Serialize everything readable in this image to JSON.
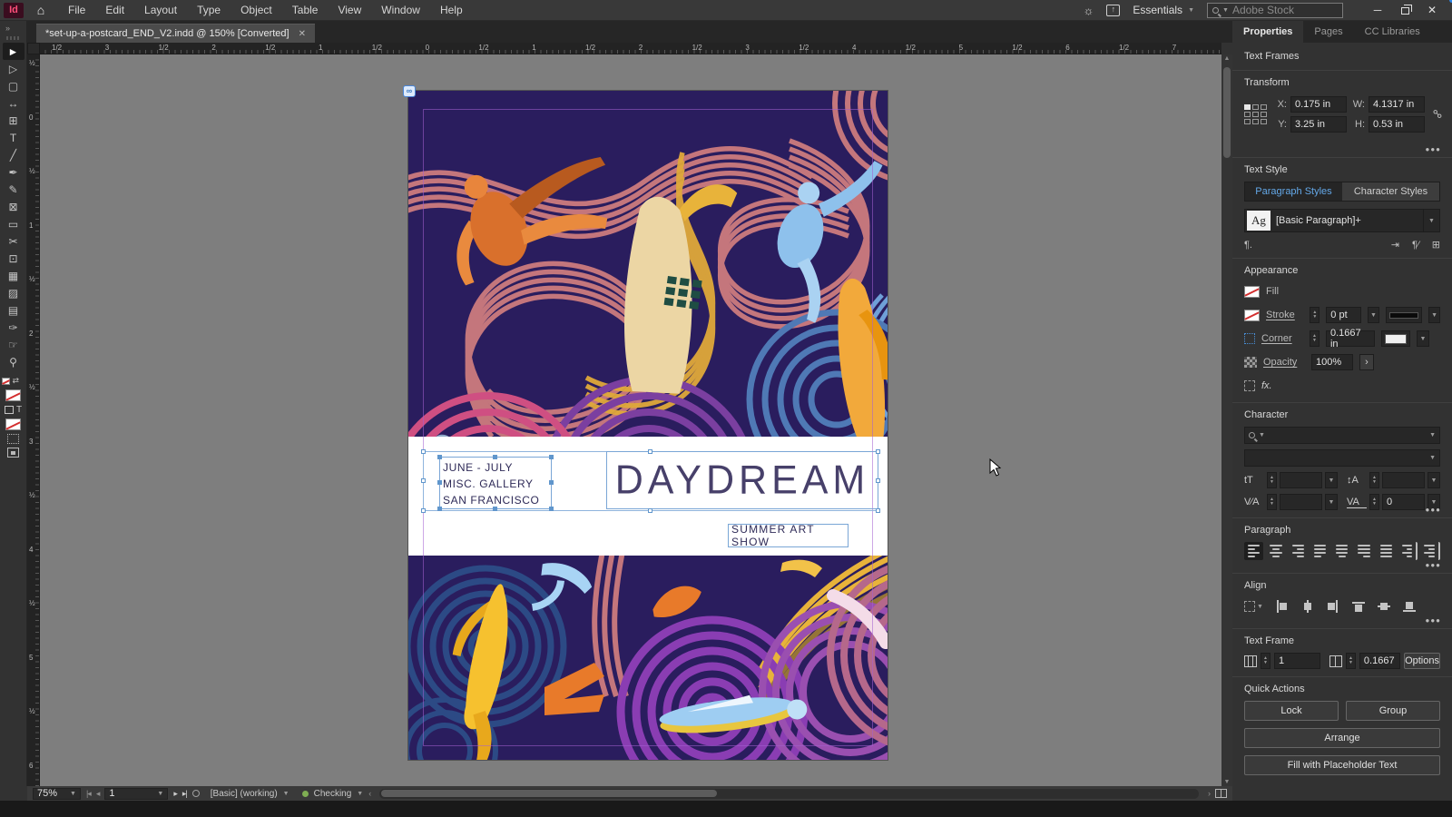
{
  "app": {
    "logo": "Id",
    "menu": [
      "File",
      "Edit",
      "Layout",
      "Type",
      "Object",
      "Table",
      "View",
      "Window",
      "Help"
    ],
    "workspace": "Essentials",
    "search_placeholder": "Adobe Stock",
    "window_minimize": "─",
    "window_close": "✕"
  },
  "document": {
    "tab_title": "*set-up-a-postcard_END_V2.indd @ 150% [Converted]",
    "tab_close": "✕",
    "panel_collapse": "»"
  },
  "tools": [
    {
      "name": "selection-tool",
      "glyph": "►",
      "selected": true
    },
    {
      "name": "direct-selection-tool",
      "glyph": "▷"
    },
    {
      "name": "page-tool",
      "glyph": "▢"
    },
    {
      "name": "gap-tool",
      "glyph": "↔"
    },
    {
      "name": "content-collector-tool",
      "glyph": "⊞"
    },
    {
      "name": "type-tool",
      "glyph": "T"
    },
    {
      "name": "line-tool",
      "glyph": "╱"
    },
    {
      "name": "pen-tool",
      "glyph": "✒"
    },
    {
      "name": "pencil-tool",
      "glyph": "✎"
    },
    {
      "name": "frame-tool",
      "glyph": "⊠"
    },
    {
      "name": "rectangle-tool",
      "glyph": "▭"
    },
    {
      "name": "scissors-tool",
      "glyph": "✂"
    },
    {
      "name": "free-transform-tool",
      "glyph": "⊡"
    },
    {
      "name": "gradient-swatch-tool",
      "glyph": "▦"
    },
    {
      "name": "gradient-feather-tool",
      "glyph": "▨"
    },
    {
      "name": "note-tool",
      "glyph": "▤"
    },
    {
      "name": "eyedropper-tool",
      "glyph": "✑"
    },
    {
      "name": "hand-tool",
      "glyph": "☞"
    },
    {
      "name": "zoom-tool",
      "glyph": "⚲"
    }
  ],
  "rulers": {
    "horizontal": [
      "1/2",
      "3",
      "1/2",
      "2",
      "1/2",
      "1",
      "1/2",
      "0",
      "1/2",
      "1",
      "1/2",
      "2",
      "1/2",
      "3",
      "1/2",
      "4",
      "1/2",
      "5",
      "1/2",
      "6",
      "1/2",
      "7"
    ],
    "vertical": [
      "½",
      "0",
      "½",
      "1",
      "½",
      "2",
      "½",
      "3",
      "½",
      "4",
      "½",
      "5",
      "½",
      "6"
    ]
  },
  "canvas": {
    "postcard": {
      "dates": "JUNE - JULY",
      "venue": "MISC. GALLERY",
      "city": "SAN FRANCISCO",
      "title": "DAYDREAM",
      "subtitle": "SUMMER ART SHOW"
    },
    "link_badge": "∞"
  },
  "statusbar": {
    "zoom": "75%",
    "page": "1",
    "preset": "[Basic] (working)",
    "status": "Checking"
  },
  "properties": {
    "tabs": {
      "properties": "Properties",
      "pages": "Pages",
      "cc_libraries": "CC Libraries"
    },
    "selection_type": "Text Frames",
    "transform": {
      "heading": "Transform",
      "x_label": "X:",
      "x": "0.175 in",
      "y_label": "Y:",
      "y": "3.25 in",
      "w_label": "W:",
      "w": "4.1317 in",
      "h_label": "H:",
      "h": "0.53 in"
    },
    "text_style": {
      "heading": "Text Style",
      "paragraph_styles_tab": "Paragraph Styles",
      "character_styles_tab": "Character Styles",
      "style_sample": "Ag",
      "style_name": "[Basic Paragraph]+"
    },
    "appearance": {
      "heading": "Appearance",
      "fill_label": "Fill",
      "stroke_label": "Stroke",
      "stroke_value": "0 pt",
      "corner_label": "Corner",
      "corner_value": "0.1667 in",
      "opacity_label": "Opacity",
      "opacity_value": "100%",
      "fx_label": "fx."
    },
    "character": {
      "heading": "Character",
      "tracking_value": "0"
    },
    "paragraph": {
      "heading": "Paragraph"
    },
    "align": {
      "heading": "Align"
    },
    "text_frame": {
      "heading": "Text Frame",
      "columns_value": "1",
      "gutter_value": "0.1667",
      "options_label": "Options"
    },
    "quick_actions": {
      "heading": "Quick Actions",
      "lock_label": "Lock",
      "group_label": "Group",
      "arrange_label": "Arrange",
      "fill_placeholder_label": "Fill with Placeholder Text"
    }
  }
}
